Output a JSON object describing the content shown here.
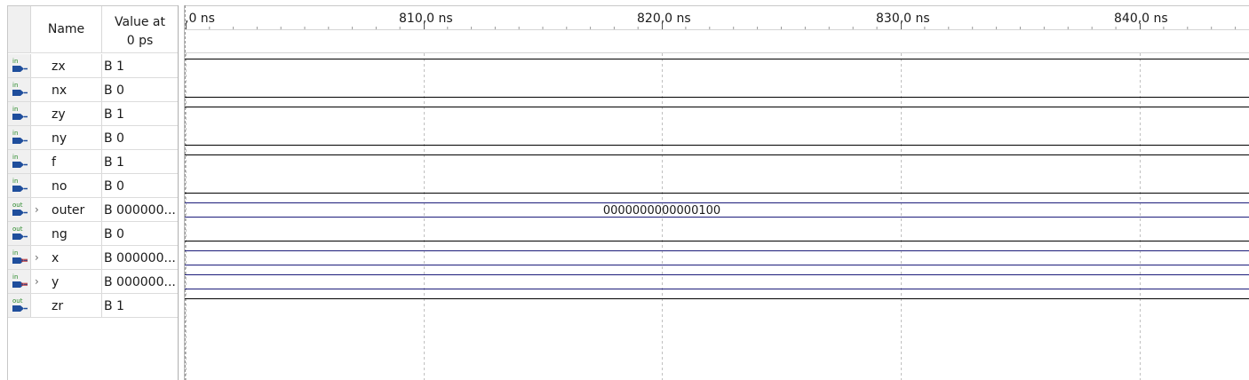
{
  "header": {
    "name_label": "Name",
    "value_label_line1": "Value at",
    "value_label_line2": "0 ps"
  },
  "timeline": {
    "ticks": [
      {
        "label": ",0 ns"
      },
      {
        "label": "810,0 ns"
      },
      {
        "label": "820,0 ns"
      },
      {
        "label": "830,0 ns"
      },
      {
        "label": "840,0 ns"
      }
    ]
  },
  "signals": [
    {
      "direction": "in",
      "name": "zx",
      "value": "B 1",
      "bus": false,
      "wave_value": "1"
    },
    {
      "direction": "in",
      "name": "nx",
      "value": "B 0",
      "bus": false,
      "wave_value": "0"
    },
    {
      "direction": "in",
      "name": "zy",
      "value": "B 1",
      "bus": false,
      "wave_value": "1"
    },
    {
      "direction": "in",
      "name": "ny",
      "value": "B 0",
      "bus": false,
      "wave_value": "0"
    },
    {
      "direction": "in",
      "name": "f",
      "value": "B 1",
      "bus": false,
      "wave_value": "1"
    },
    {
      "direction": "in",
      "name": "no",
      "value": "B 0",
      "bus": false,
      "wave_value": "0"
    },
    {
      "direction": "out",
      "name": "outer",
      "value": "B 000000...",
      "bus": true,
      "wave_label": "0000000000000100"
    },
    {
      "direction": "out",
      "name": "ng",
      "value": "B 0",
      "bus": false,
      "wave_value": "0"
    },
    {
      "direction": "in",
      "name": "x",
      "value": "B 000000...",
      "bus": true,
      "wave_label": ""
    },
    {
      "direction": "in",
      "name": "y",
      "value": "B 000000...",
      "bus": true,
      "wave_label": ""
    },
    {
      "direction": "out",
      "name": "zr",
      "value": "B 1",
      "bus": false,
      "wave_value": "1"
    }
  ],
  "icons": {
    "input_pin": "input-pin-icon",
    "output_pin": "output-pin-icon",
    "input_bus": "input-bus-icon",
    "expander": "chevron-right-icon"
  },
  "colors": {
    "pin_label": "#2a8a2a",
    "pin_body": "#1f4e9c",
    "bus_stripe": "#c03030",
    "trace": "#000000",
    "bus_trace": "#1c1c7a",
    "grid": "#c0c0c0"
  }
}
